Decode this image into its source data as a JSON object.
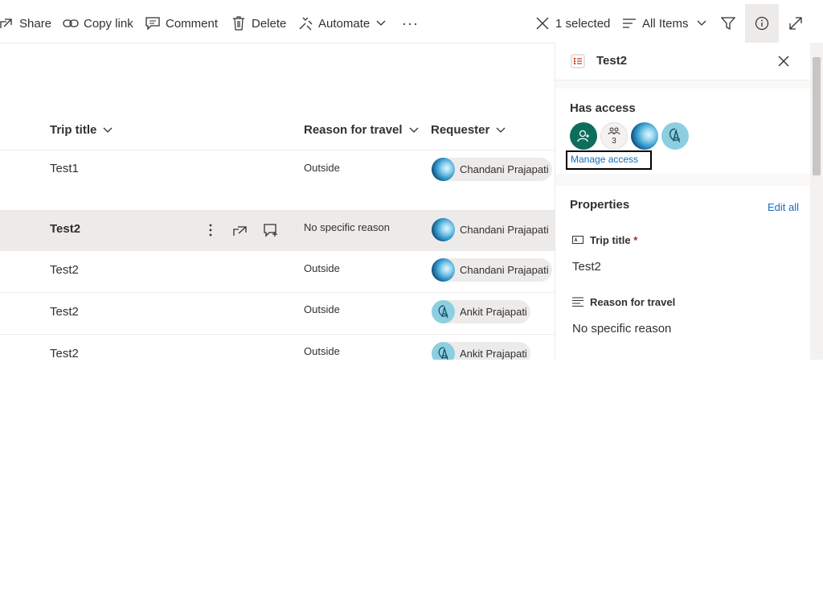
{
  "toolbar": {
    "share": "Share",
    "copy_link": "Copy link",
    "comment": "Comment",
    "delete": "Delete",
    "automate": "Automate",
    "more": "···",
    "selection_count": "1 selected",
    "view": "All Items"
  },
  "columns": {
    "title": "Trip title",
    "reason": "Reason for travel",
    "requester": "Requester"
  },
  "rows": [
    {
      "title": "Test1",
      "reason": "Outside",
      "requester": "Chandani Prajapati",
      "avatar": "photo"
    },
    {
      "title": "Test2",
      "reason": "No specific reason",
      "requester": "Chandani Prajapati",
      "avatar": "photo",
      "selected": true
    },
    {
      "title": "Test2",
      "reason": "Outside",
      "requester": "Chandani Prajapati",
      "avatar": "photo"
    },
    {
      "title": "Test2",
      "reason": "Outside",
      "requester": "Ankit Prajapati",
      "avatar": "logo"
    },
    {
      "title": "Test2",
      "reason": "Outside",
      "requester": "Ankit Prajapati",
      "avatar": "logo"
    }
  ],
  "pane": {
    "title": "Test2",
    "has_access": "Has access",
    "group_count": "3",
    "manage_access": "Manage access",
    "properties": "Properties",
    "edit_all": "Edit all",
    "fields": [
      {
        "label": "Trip title",
        "required": "*",
        "value": "Test2",
        "icon": "text-field-icon"
      },
      {
        "label": "Reason for travel",
        "value": "No specific reason",
        "icon": "multiline-text-icon"
      }
    ]
  },
  "colors": {
    "accent": "#106ebe",
    "owner_avatar": "#0e6e5c",
    "selected_row": "#edebe9",
    "pane_bg": "#faf9f8"
  }
}
